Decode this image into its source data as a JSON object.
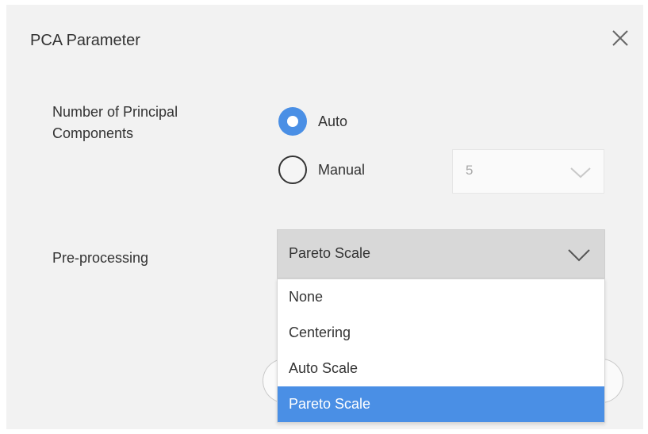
{
  "dialog": {
    "title": "PCA Parameter",
    "close_icon": "close-icon"
  },
  "principal_components": {
    "label": "Number of Principal Components",
    "mode_selected": "Auto",
    "options": [
      {
        "label": "Auto",
        "checked": true
      },
      {
        "label": "Manual",
        "checked": false
      }
    ],
    "manual_value": "5"
  },
  "preprocessing": {
    "label": "Pre-processing",
    "selected": "Pareto Scale",
    "options": [
      "None",
      "Centering",
      "Auto Scale",
      "Pareto Scale"
    ]
  },
  "colors": {
    "accent": "#4a8fe5",
    "dialog_bg": "#f2f2f2"
  }
}
